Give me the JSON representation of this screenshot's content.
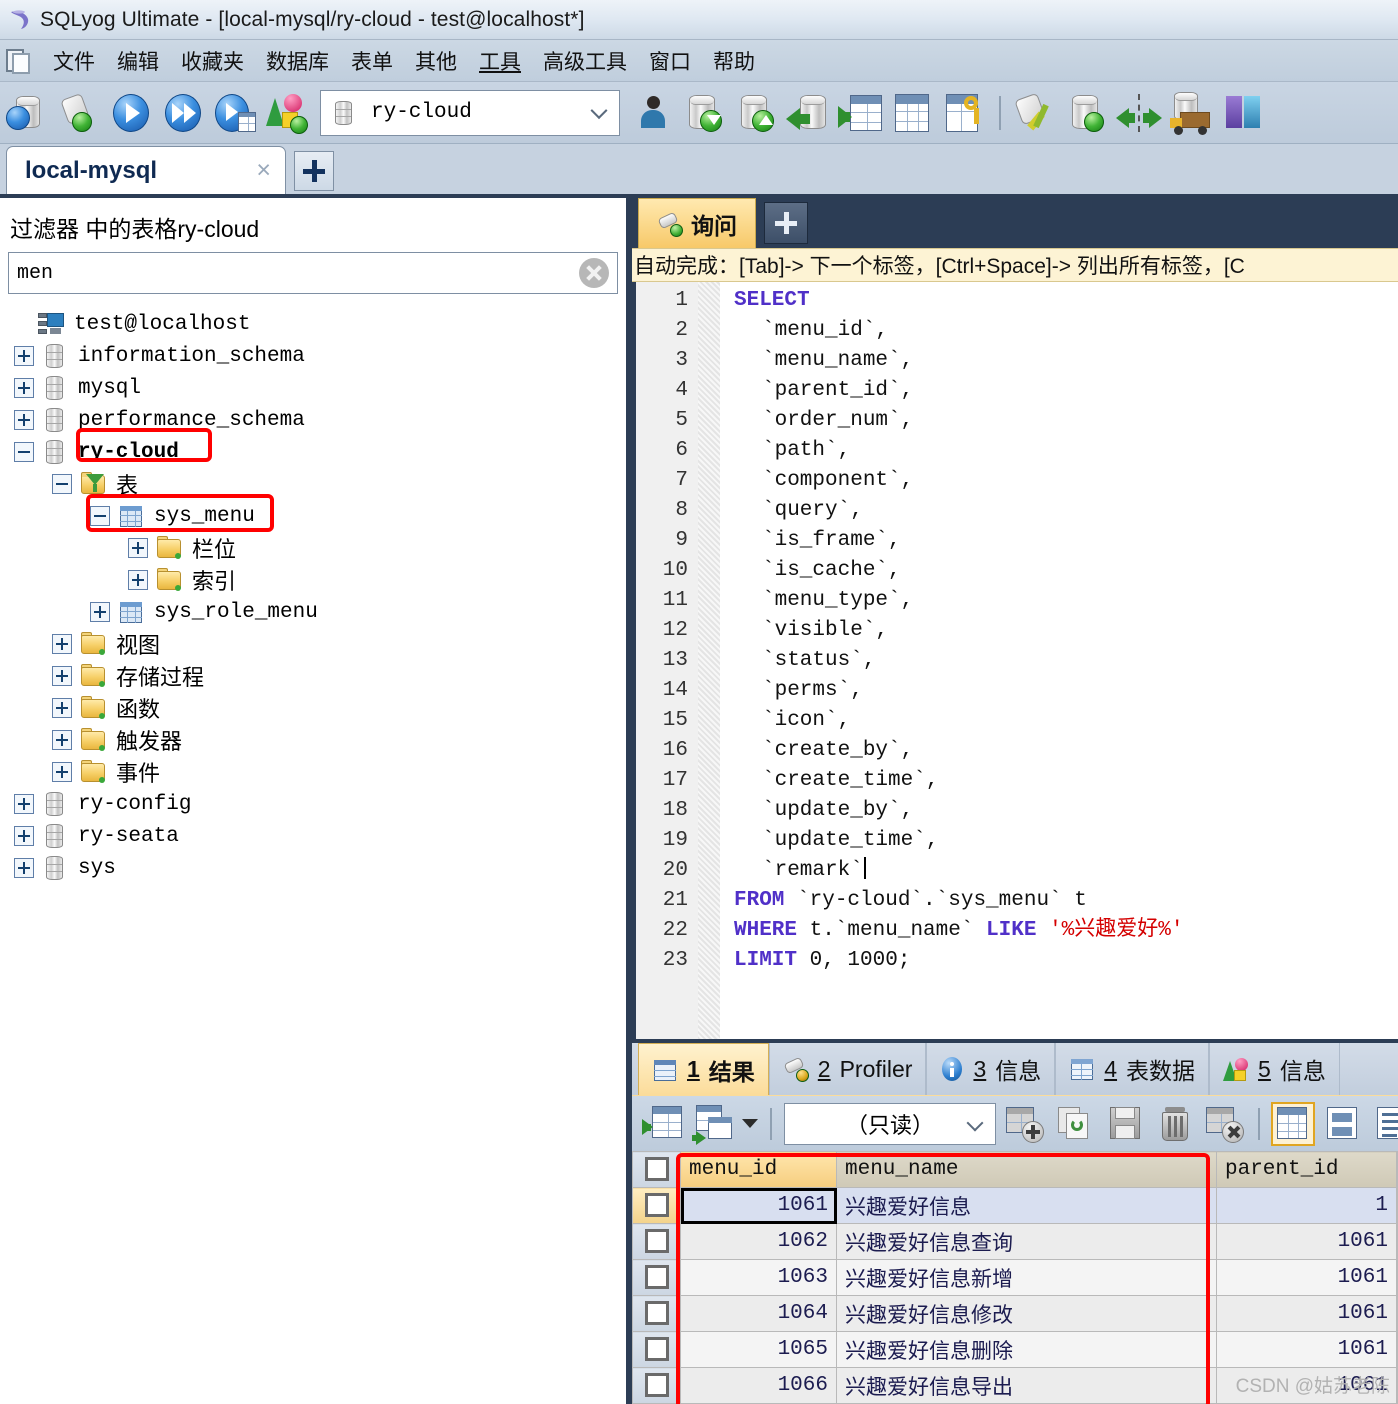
{
  "window": {
    "title": "SQLyog Ultimate - [local-mysql/ry-cloud - test@localhost*]",
    "logo_icon": "dolphin-icon"
  },
  "menubar": {
    "items": [
      {
        "label": "文件"
      },
      {
        "label": "编辑"
      },
      {
        "label": "收藏夹"
      },
      {
        "label": "数据库"
      },
      {
        "label": "表单"
      },
      {
        "label": "其他"
      },
      {
        "label": "工具"
      },
      {
        "label": "高级工具"
      },
      {
        "label": "窗口"
      },
      {
        "label": "帮助"
      }
    ]
  },
  "toolbar": {
    "db_selector_value": "ry-cloud",
    "icons": [
      "new-connection-icon",
      "new-connection-add-icon",
      "execute-query-icon",
      "execute-all-queries-icon",
      "execute-query-stepwise-icon",
      "schema-designer-icon"
    ],
    "icons_right": [
      "user-manager-icon",
      "import-database-icon",
      "export-database-icon",
      "restore-from-dump-icon",
      "import-external-data-icon",
      "table-data-icon",
      "manage-index-icon",
      "sql-formatter-icon",
      "sync-database-icon",
      "compare-schema-icon",
      "backup-icon"
    ]
  },
  "connection_tabs": {
    "tabs": [
      {
        "label": "local-mysql",
        "close_label": "×",
        "active": true
      }
    ],
    "add_label": "+"
  },
  "sidebar": {
    "filter_label": "过滤器 中的表格ry-cloud",
    "filter_input_value": "men",
    "filter_input_placeholder": "",
    "clear_icon": "clear-circle-icon",
    "tree": [
      {
        "label": "test@localhost",
        "icon": "server-icon",
        "depth": 0,
        "expander": "none",
        "highlight": false
      },
      {
        "label": "information_schema",
        "icon": "database-icon",
        "depth": 1,
        "expander": "plus",
        "highlight": false
      },
      {
        "label": "mysql",
        "icon": "database-icon",
        "depth": 1,
        "expander": "plus",
        "highlight": false
      },
      {
        "label": "performance_schema",
        "icon": "database-icon",
        "depth": 1,
        "expander": "plus",
        "highlight": false
      },
      {
        "label": "ry-cloud",
        "icon": "database-icon",
        "depth": 1,
        "expander": "minus",
        "highlight": true,
        "bold": true
      },
      {
        "label": "表",
        "icon": "filter-folder-icon",
        "depth": 2,
        "expander": "minus",
        "highlight": false,
        "cjk": true
      },
      {
        "label": "sys_menu",
        "icon": "table-icon",
        "depth": 3,
        "expander": "minus",
        "highlight": true
      },
      {
        "label": "栏位",
        "icon": "folder-icon",
        "depth": 4,
        "expander": "plus",
        "highlight": false,
        "cjk": true
      },
      {
        "label": "索引",
        "icon": "folder-icon",
        "depth": 4,
        "expander": "plus",
        "highlight": false,
        "cjk": true
      },
      {
        "label": "sys_role_menu",
        "icon": "table-icon",
        "depth": 3,
        "expander": "plus",
        "highlight": false
      },
      {
        "label": "视图",
        "icon": "folder-icon",
        "depth": 2,
        "expander": "plus",
        "highlight": false,
        "cjk": true
      },
      {
        "label": "存储过程",
        "icon": "folder-icon",
        "depth": 2,
        "expander": "plus",
        "highlight": false,
        "cjk": true
      },
      {
        "label": "函数",
        "icon": "folder-icon",
        "depth": 2,
        "expander": "plus",
        "highlight": false,
        "cjk": true
      },
      {
        "label": "触发器",
        "icon": "folder-icon",
        "depth": 2,
        "expander": "plus",
        "highlight": false,
        "cjk": true
      },
      {
        "label": "事件",
        "icon": "folder-icon",
        "depth": 2,
        "expander": "plus",
        "highlight": false,
        "cjk": true
      },
      {
        "label": "ry-config",
        "icon": "database-icon",
        "depth": 1,
        "expander": "plus",
        "highlight": false
      },
      {
        "label": "ry-seata",
        "icon": "database-icon",
        "depth": 1,
        "expander": "plus",
        "highlight": false
      },
      {
        "label": "sys",
        "icon": "database-icon",
        "depth": 1,
        "expander": "plus",
        "highlight": false
      }
    ]
  },
  "query": {
    "tab_label": "询问",
    "tab_icon": "plugin-icon",
    "add_label": "+",
    "hint": "自动完成：[Tab]-> 下一个标签，[Ctrl+Space]-> 列出所有标签，[C",
    "lines": [
      {
        "n": "1",
        "indent": 0,
        "parts": [
          {
            "t": "SELECT",
            "c": "kw"
          }
        ]
      },
      {
        "n": "2",
        "indent": 1,
        "parts": [
          {
            "t": "`menu_id`,",
            "c": "ident"
          }
        ]
      },
      {
        "n": "3",
        "indent": 1,
        "parts": [
          {
            "t": "`menu_name`,",
            "c": "ident"
          }
        ]
      },
      {
        "n": "4",
        "indent": 1,
        "parts": [
          {
            "t": "`parent_id`,",
            "c": "ident"
          }
        ]
      },
      {
        "n": "5",
        "indent": 1,
        "parts": [
          {
            "t": "`order_num`,",
            "c": "ident"
          }
        ]
      },
      {
        "n": "6",
        "indent": 1,
        "parts": [
          {
            "t": "`path`,",
            "c": "ident"
          }
        ]
      },
      {
        "n": "7",
        "indent": 1,
        "parts": [
          {
            "t": "`component`,",
            "c": "ident"
          }
        ]
      },
      {
        "n": "8",
        "indent": 1,
        "parts": [
          {
            "t": "`query`,",
            "c": "ident"
          }
        ]
      },
      {
        "n": "9",
        "indent": 1,
        "parts": [
          {
            "t": "`is_frame`,",
            "c": "ident"
          }
        ]
      },
      {
        "n": "10",
        "indent": 1,
        "parts": [
          {
            "t": "`is_cache`,",
            "c": "ident"
          }
        ]
      },
      {
        "n": "11",
        "indent": 1,
        "parts": [
          {
            "t": "`menu_type`,",
            "c": "ident"
          }
        ]
      },
      {
        "n": "12",
        "indent": 1,
        "parts": [
          {
            "t": "`visible`,",
            "c": "ident"
          }
        ]
      },
      {
        "n": "13",
        "indent": 1,
        "parts": [
          {
            "t": "`status`,",
            "c": "ident"
          }
        ]
      },
      {
        "n": "14",
        "indent": 1,
        "parts": [
          {
            "t": "`perms`,",
            "c": "ident"
          }
        ]
      },
      {
        "n": "15",
        "indent": 1,
        "parts": [
          {
            "t": "`icon`,",
            "c": "ident"
          }
        ]
      },
      {
        "n": "16",
        "indent": 1,
        "parts": [
          {
            "t": "`create_by`,",
            "c": "ident"
          }
        ]
      },
      {
        "n": "17",
        "indent": 1,
        "parts": [
          {
            "t": "`create_time`,",
            "c": "ident"
          }
        ]
      },
      {
        "n": "18",
        "indent": 1,
        "parts": [
          {
            "t": "`update_by`,",
            "c": "ident"
          }
        ]
      },
      {
        "n": "19",
        "indent": 1,
        "parts": [
          {
            "t": "`update_time`,",
            "c": "ident"
          }
        ]
      },
      {
        "n": "20",
        "indent": 1,
        "parts": [
          {
            "t": "`remark`",
            "c": "ident"
          }
        ],
        "caret": true
      },
      {
        "n": "21",
        "indent": 0,
        "parts": [
          {
            "t": "FROM ",
            "c": "kw"
          },
          {
            "t": "`ry-cloud`.`sys_menu` t",
            "c": "ident"
          }
        ]
      },
      {
        "n": "22",
        "indent": 0,
        "parts": [
          {
            "t": "WHERE ",
            "c": "kw"
          },
          {
            "t": "t.`menu_name` ",
            "c": "ident"
          },
          {
            "t": "LIKE ",
            "c": "kw"
          },
          {
            "t": "'%兴趣爱好%'",
            "c": "str"
          }
        ]
      },
      {
        "n": "23",
        "indent": 0,
        "parts": [
          {
            "t": "LIMIT ",
            "c": "kw"
          },
          {
            "t": "0, 1000;",
            "c": "ident"
          }
        ]
      }
    ]
  },
  "results": {
    "tabs": [
      {
        "num": "1",
        "label": "结果",
        "icon": "result-grid-icon",
        "active": true
      },
      {
        "num": "2",
        "label": "Profiler",
        "icon": "profiler-icon",
        "active": false
      },
      {
        "num": "3",
        "label": "信息",
        "icon": "info-icon",
        "active": false
      },
      {
        "num": "4",
        "label": "表数据",
        "icon": "table-data-icon",
        "active": false
      },
      {
        "num": "5",
        "label": "信息",
        "icon": "objects-info-icon",
        "active": false
      }
    ],
    "toolbar": {
      "mode_value": "（只读）",
      "icons": [
        "refresh-grid-icon",
        "open-in-new-tab-icon",
        "dropdown-caret-icon",
        "insert-row-icon",
        "duplicate-row-icon",
        "save-changes-icon",
        "delete-row-icon",
        "cancel-changes-icon",
        "grid-view-icon",
        "form-view-icon",
        "text-view-icon"
      ]
    },
    "columns": [
      "menu_id",
      "menu_name",
      "parent_id"
    ],
    "selected_column": "menu_id",
    "rows": [
      {
        "menu_id": "1061",
        "menu_name": "兴趣爱好信息",
        "parent_id": "1",
        "selected": true
      },
      {
        "menu_id": "1062",
        "menu_name": "兴趣爱好信息查询",
        "parent_id": "1061",
        "selected": false
      },
      {
        "menu_id": "1063",
        "menu_name": "兴趣爱好信息新增",
        "parent_id": "1061",
        "selected": false
      },
      {
        "menu_id": "1064",
        "menu_name": "兴趣爱好信息修改",
        "parent_id": "1061",
        "selected": false
      },
      {
        "menu_id": "1065",
        "menu_name": "兴趣爱好信息删除",
        "parent_id": "1061",
        "selected": false
      },
      {
        "menu_id": "1066",
        "menu_name": "兴趣爱好信息导出",
        "parent_id": "1061",
        "selected": false
      }
    ],
    "watermark": "CSDN @姑苏老陈"
  },
  "colors": {
    "highlight_red": "#ff0000",
    "accent_amber": "#f6cd7e",
    "chrome_blue": "#2c3d55"
  }
}
